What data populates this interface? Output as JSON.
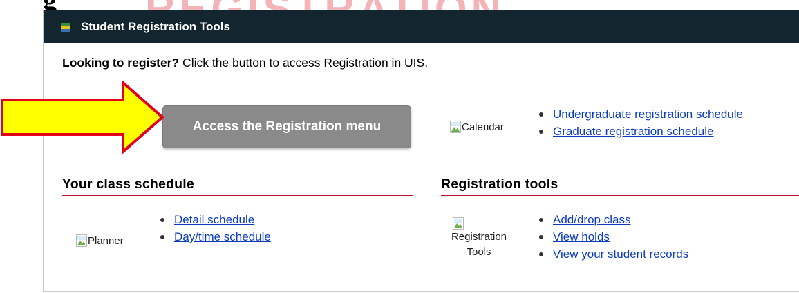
{
  "background": {
    "heading_fragment": "g",
    "watermark_text": "REGISTRATION",
    "watermark_color": "#f3b3b7"
  },
  "panel": {
    "title": "Student Registration Tools",
    "icon": "flag-icon",
    "header_color": "#13252f"
  },
  "intro": {
    "bold": "Looking to register?",
    "rest": " Click the button to access Registration in UIS."
  },
  "arrow": {
    "fill": "#ffff00",
    "stroke": "#e3001b"
  },
  "register_button": {
    "label": "Access the Registration menu"
  },
  "calendar": {
    "image_alt": "Calendar",
    "links": [
      "Undergraduate registration schedule",
      "Graduate registration schedule"
    ]
  },
  "class_schedule": {
    "heading": "Your class schedule",
    "image_alt": "Planner",
    "links": [
      "Detail schedule",
      "Day/time schedule"
    ]
  },
  "registration_tools": {
    "heading": "Registration tools",
    "image_alt_line1": "Registration",
    "image_alt_line2": "Tools",
    "links": [
      "Add/drop class",
      "View holds",
      "View your student records"
    ]
  },
  "colors": {
    "link": "#0d3dbd",
    "rule": "#c0192b",
    "button": "#8a8a8a"
  }
}
